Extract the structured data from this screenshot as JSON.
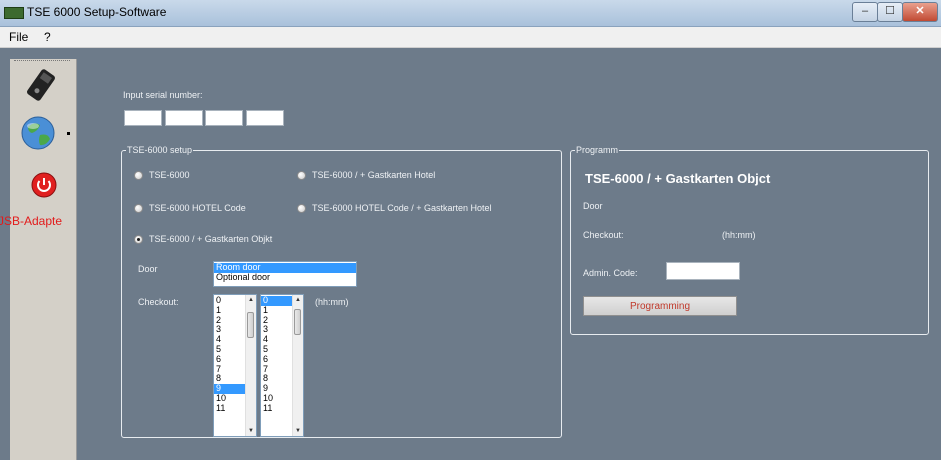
{
  "window": {
    "title": "TSE 6000 Setup-Software",
    "min_label": "–",
    "max_label": "☐",
    "close_label": "✕"
  },
  "menu": {
    "items": [
      "File",
      "?"
    ]
  },
  "sidebar": {
    "adapter_label": "JSB-Adapte"
  },
  "serial": {
    "label": "Input serial number:"
  },
  "setup": {
    "title": "TSE-6000 setup",
    "options": [
      {
        "label": "TSE-6000",
        "checked": false
      },
      {
        "label": "TSE-6000 / + Gastkarten Hotel",
        "checked": false
      },
      {
        "label": "TSE-6000 HOTEL Code",
        "checked": false
      },
      {
        "label": "TSE-6000 HOTEL Code / + Gastkarten Hotel",
        "checked": false
      },
      {
        "label": "TSE-6000 / + Gastkarten Objkt",
        "checked": true
      }
    ],
    "door_label": "Door",
    "door_options": [
      "Room door",
      "Optional door"
    ],
    "door_selected_index": 0,
    "checkout_label": "Checkout:",
    "checkout_unit": "(hh:mm)",
    "hours": [
      "0",
      "1",
      "2",
      "3",
      "4",
      "5",
      "6",
      "7",
      "8",
      "9",
      "10",
      "11"
    ],
    "hours_selected_index": 9,
    "minutes": [
      "0",
      "1",
      "2",
      "3",
      "4",
      "5",
      "6",
      "7",
      "8",
      "9",
      "10",
      "11"
    ],
    "minutes_selected_index": 0
  },
  "programm": {
    "group_title": "Programm",
    "title": "TSE-6000 / + Gastkarten Objct",
    "door_label": "Door",
    "checkout_label": "Checkout:",
    "checkout_unit": "(hh:mm)",
    "admin_label": "Admin. Code:",
    "admin_value": "",
    "button_label": "Programming"
  }
}
